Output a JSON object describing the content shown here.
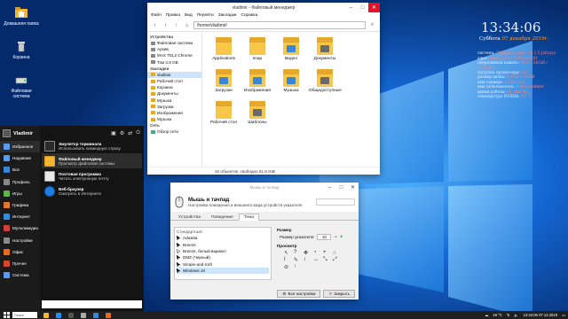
{
  "desktop": {
    "icons": [
      {
        "label": "Домашняя папка",
        "icon": "home-folder-icon"
      },
      {
        "label": "Корзина",
        "icon": "trash-icon"
      },
      {
        "label": "Файловая система",
        "icon": "drive-icon"
      }
    ]
  },
  "conky": {
    "time": "13:34:06",
    "date_prefix": "Суббота",
    "date_highlight": "07 декабря 2019г.",
    "rows": [
      {
        "k": "система:",
        "v": "\"Manjaro Linux\" 18.1.5 Juhraya"
      },
      {
        "k": "ядро:",
        "v": "Linux 5.3.12-1-MANJARO"
      },
      {
        "k": "оперативная память:",
        "v": "40% 1,56GiB / 3,84GiB"
      },
      {
        "k": "загрузка процессора:",
        "v": "13%"
      },
      {
        "k": "размер диска:",
        "v": "6,4GiB / 19GiB"
      },
      {
        "k": "имя сервера:",
        "v": "vladimir-pc"
      },
      {
        "k": "имя пользователя:",
        "v": "Home/Vladimir"
      },
      {
        "k": "время работы:",
        "v": "0h 30m 42s"
      },
      {
        "k": "температура NVIDIA:",
        "v": "39° C"
      }
    ]
  },
  "file_manager": {
    "title": "vladimir - Файловый менеджер",
    "menu": [
      "Файл",
      "Правка",
      "Вид",
      "Перейти",
      "Закладки",
      "Справка"
    ],
    "path": "/home/vladimir/",
    "sidebar": {
      "devices_title": "Устройства",
      "devices": [
        "Файловая система",
        "Архив",
        "MAX TEL2 Chrome",
        "Том 3.8 GB"
      ],
      "bookmarks_title": "Закладки",
      "bookmarks": [
        "vladimir",
        "Рабочий стол",
        "Корзина",
        "Документы",
        "Музыка",
        "Загрузки",
        "Изображения",
        "Музыка"
      ],
      "network_title": "Сеть",
      "network": [
        "Обзор сети"
      ]
    },
    "files": [
      {
        "name": "Applications",
        "badge": "apps",
        "color": "#f8c74a"
      },
      {
        "name": "snap",
        "badge": "",
        "color": "#f8c74a"
      },
      {
        "name": "Видео",
        "badge": "video",
        "color": "#3a86d6"
      },
      {
        "name": "Документы",
        "badge": "doc",
        "color": "#6a6a6a"
      },
      {
        "name": "",
        "badge": "",
        "color": ""
      },
      {
        "name": "Загрузки",
        "badge": "download",
        "color": "#3a86d6"
      },
      {
        "name": "Изображения",
        "badge": "pictures",
        "color": "#3a86d6"
      },
      {
        "name": "Музыка",
        "badge": "music",
        "color": "#3a86d6"
      },
      {
        "name": "Общедоступные",
        "badge": "public",
        "color": "#6a6a6a"
      },
      {
        "name": "",
        "badge": "",
        "color": ""
      },
      {
        "name": "Рабочий стол",
        "badge": "",
        "color": "#3a86d6"
      },
      {
        "name": "Шаблоны",
        "badge": "templates",
        "color": "#6a6a6a"
      }
    ],
    "status": "10 объектов, свободно 61,8 GiB"
  },
  "mouse_settings": {
    "window_title": "Мышь и тачпад",
    "heading": "Мышь и тачпад",
    "subtitle": "Настройка поведения и внешнего вида устройств указателя",
    "tabs": [
      "Устройства",
      "Поведение",
      "Тема"
    ],
    "themes_header": "Стандартный",
    "themes": [
      "Adwaita",
      "Breeze",
      "Breeze, белый вариант",
      "DMZ (Черный)",
      "Simple-and-Soft",
      "Windows 10"
    ],
    "size_label": "Размер",
    "pointer_size_label": "Размер указателя:",
    "pointer_size": "10",
    "preview_label": "Просмотр",
    "help_button": "Справка",
    "settings_button": "Все настройки",
    "close_button": "Закрыть"
  },
  "start_menu": {
    "user": "Vladimir",
    "categories": [
      "Избранное",
      "Недавние",
      "Все",
      "Профиль",
      "Игры",
      "Графика",
      "Интернет",
      "Мультимедиа",
      "Настройки",
      "Офис",
      "Прочее",
      "Система"
    ],
    "apps": [
      {
        "title": "Эмулятор терминала",
        "desc": "Использовать командную строку"
      },
      {
        "title": "Файловый менеджер",
        "desc": "Просмотр файловой системы"
      },
      {
        "title": "Почтовая программа",
        "desc": "Читать электронную почту"
      },
      {
        "title": "Веб-браузер",
        "desc": "Смотреть в Интернете"
      }
    ]
  },
  "taskbar": {
    "search_placeholder": "Поиск",
    "temperature": "18 °C",
    "time": "13:34:06",
    "date": "07.12.2019",
    "colors": {
      "accent": "#1e90ff",
      "bar": "#1f1f1f"
    }
  }
}
